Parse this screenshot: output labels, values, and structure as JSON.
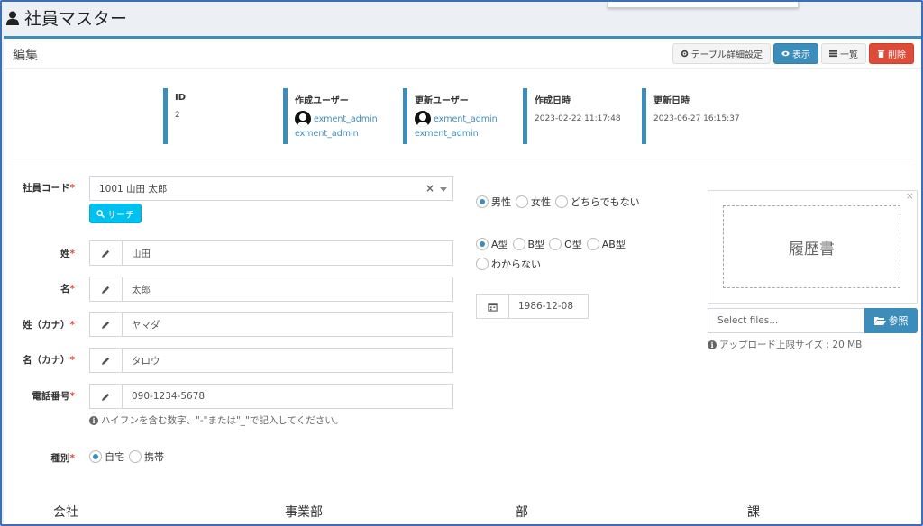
{
  "app": {
    "title": "社員マスター",
    "user_icon": "user-icon"
  },
  "box": {
    "title": "編集"
  },
  "toolbar": {
    "table_settings": "テーブル詳細設定",
    "view": "表示",
    "list": "一覧",
    "delete": "削除"
  },
  "meta": {
    "id": {
      "label": "ID",
      "value": "2"
    },
    "created_user": {
      "label": "作成ユーザー",
      "name": "exment_admin",
      "sub": "exment_admin"
    },
    "updated_user": {
      "label": "更新ユーザー",
      "name": "exment_admin",
      "sub": "exment_admin"
    },
    "created_at": {
      "label": "作成日時",
      "value": "2023-02-22 11:17:48"
    },
    "updated_at": {
      "label": "更新日時",
      "value": "2023-06-27 16:15:37"
    }
  },
  "form": {
    "employee_code": {
      "label": "社員コード",
      "value": "1001 山田 太郎",
      "search_label": "サーチ"
    },
    "last_name": {
      "label": "姓",
      "value": "山田"
    },
    "first_name": {
      "label": "名",
      "value": "太郎"
    },
    "last_name_kana": {
      "label": "姓（カナ）",
      "value": "ヤマダ"
    },
    "first_name_kana": {
      "label": "名（カナ）",
      "value": "タロウ"
    },
    "phone": {
      "label": "電話番号",
      "value": "090-1234-5678",
      "help": "ハイフンを含む数字、\"-\"または\"_\"で記入してください。"
    },
    "phone_type": {
      "label": "種別",
      "options": [
        "自宅",
        "携帯"
      ],
      "selected": "自宅"
    },
    "gender": {
      "options": [
        "男性",
        "女性",
        "どちらでもない"
      ],
      "selected": "男性"
    },
    "blood_type": {
      "options": [
        "A型",
        "B型",
        "O型",
        "AB型",
        "わからない"
      ],
      "selected": "A型"
    },
    "birthday": {
      "value": "1986-12-08"
    },
    "resume": {
      "preview_label": "履歴書",
      "placeholder": "Select files...",
      "browse_label": "参照",
      "help": "アップロード上限サイズ : 20 MB"
    },
    "required_mark": "*"
  },
  "table_headers": [
    "会社",
    "事業部",
    "部",
    "課"
  ],
  "colors": {
    "accent": "#3c8dbc",
    "danger": "#dd4b39",
    "info": "#00c0ef"
  }
}
